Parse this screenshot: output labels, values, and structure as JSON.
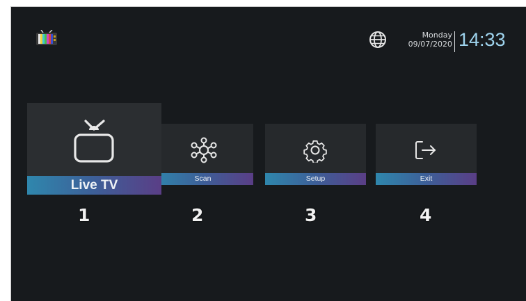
{
  "header": {
    "day": "Monday",
    "date": "09/07/2020",
    "time": "14:33",
    "logo_icon": "tv-color-bars-icon",
    "globe_icon": "globe-icon"
  },
  "menu": {
    "items": [
      {
        "label": "Live TV",
        "icon": "tv-icon",
        "number": "1",
        "selected": true
      },
      {
        "label": "Scan",
        "icon": "network-nodes-icon",
        "number": "2",
        "selected": false
      },
      {
        "label": "Setup",
        "icon": "gear-icon",
        "number": "3",
        "selected": false
      },
      {
        "label": "Exit",
        "icon": "exit-icon",
        "number": "4",
        "selected": false
      }
    ]
  },
  "colors": {
    "background": "#171a1d",
    "card": "#26292c",
    "label_gradient_start": "#2f87ad",
    "label_gradient_end": "#5a3e86",
    "time": "#9fd4ee"
  }
}
